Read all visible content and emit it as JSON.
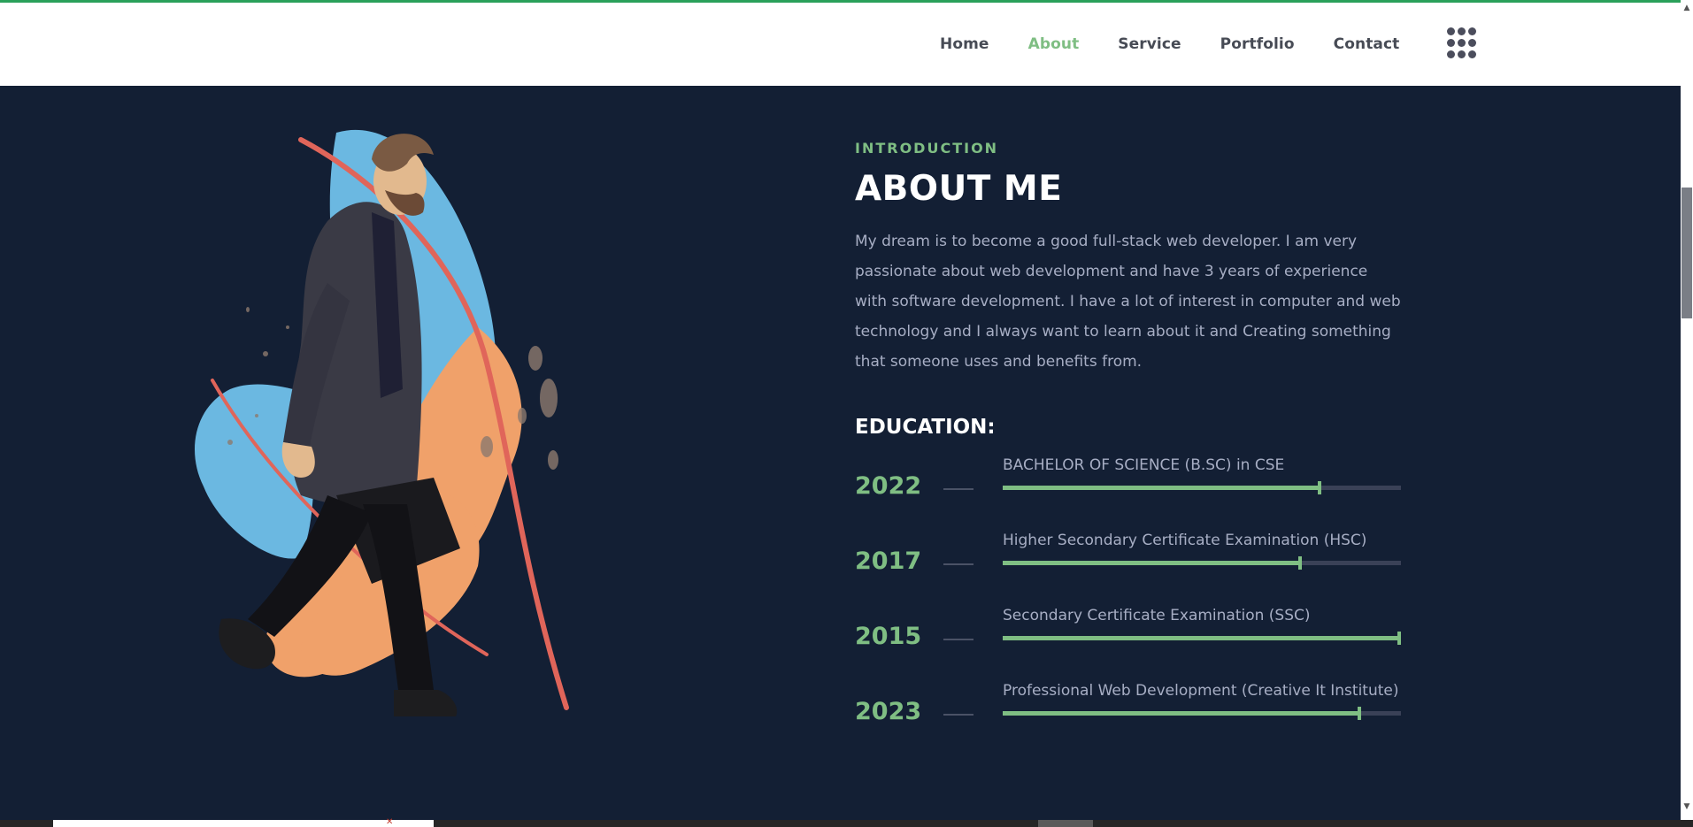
{
  "nav": {
    "items": [
      {
        "label": "Home",
        "active": false
      },
      {
        "label": "About",
        "active": true
      },
      {
        "label": "Service",
        "active": false
      },
      {
        "label": "Portfolio",
        "active": false
      },
      {
        "label": "Contact",
        "active": false
      }
    ],
    "menu_icon": "grid-dots-icon"
  },
  "about": {
    "intro_label": "INTRODUCTION",
    "title": "ABOUT ME",
    "paragraph_lines": [
      "My dream is to become a good full-stack web developer. I am very",
      "passionate about web development and have 3 years of experience",
      "with software development. I have a lot of interest in computer and web",
      "technology and I always want to learn about it and Creating something",
      "that someone uses and benefits from."
    ]
  },
  "education": {
    "heading": "EDUCATION:",
    "items": [
      {
        "year": "2022",
        "title": "BACHELOR OF SCIENCE (B.SC) in CSE",
        "progress": 0.8
      },
      {
        "year": "2017",
        "title": "Higher Secondary Certificate Examination (HSC)",
        "progress": 0.75
      },
      {
        "year": "2015",
        "title": "Secondary Certificate Examination (SSC)",
        "progress": 1.0
      },
      {
        "year": "2023",
        "title": "Professional Web Development (Creative It Institute)",
        "progress": 0.9
      }
    ]
  },
  "colors": {
    "accent": "#7fbe83",
    "background": "#131f34",
    "text": "#a7aec4",
    "top_accent": "#2aa05a"
  }
}
